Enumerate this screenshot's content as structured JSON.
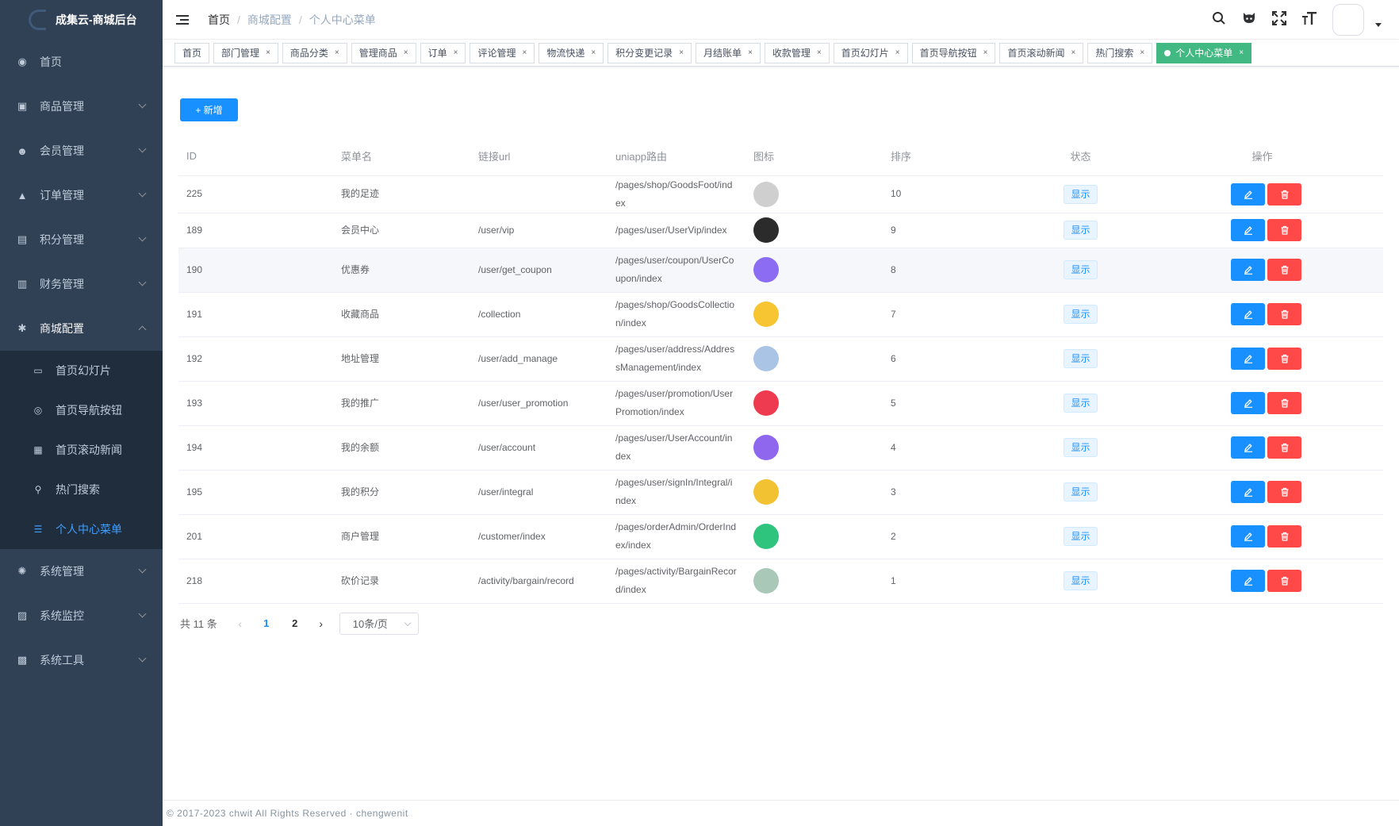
{
  "app": {
    "title": "成集云-商城后台"
  },
  "sidebar": {
    "items": [
      {
        "label": "首页",
        "icon": "dashboard-icon",
        "glyph": "◉",
        "children": false,
        "open": false
      },
      {
        "label": "商品管理",
        "icon": "goods-icon",
        "glyph": "▣",
        "children": true,
        "open": false
      },
      {
        "label": "会员管理",
        "icon": "users-icon",
        "glyph": "☻",
        "children": true,
        "open": false
      },
      {
        "label": "订单管理",
        "icon": "lock-icon",
        "glyph": "▲",
        "children": true,
        "open": false
      },
      {
        "label": "积分管理",
        "icon": "points-icon",
        "glyph": "▤",
        "children": true,
        "open": false
      },
      {
        "label": "财务管理",
        "icon": "finance-icon",
        "glyph": "▥",
        "children": true,
        "open": false
      },
      {
        "label": "商城配置",
        "icon": "gear-icon",
        "glyph": "✱",
        "children": true,
        "open": true
      }
    ],
    "submenu": [
      {
        "label": "首页幻灯片",
        "icon": "slideshow-icon",
        "glyph": "▭",
        "active": false
      },
      {
        "label": "首页导航按钮",
        "icon": "nav-button-icon",
        "glyph": "◎",
        "active": false
      },
      {
        "label": "首页滚动新闻",
        "icon": "news-icon",
        "glyph": "▦",
        "active": false
      },
      {
        "label": "热门搜索",
        "icon": "search-icon",
        "glyph": "⚲",
        "active": false
      },
      {
        "label": "个人中心菜单",
        "icon": "list-icon",
        "glyph": "☰",
        "active": true
      }
    ],
    "items_after": [
      {
        "label": "系统管理",
        "icon": "settings-icon",
        "glyph": "✺",
        "children": true
      },
      {
        "label": "系统监控",
        "icon": "monitor-icon",
        "glyph": "▨",
        "children": true
      },
      {
        "label": "系统工具",
        "icon": "toolbox-icon",
        "glyph": "▩",
        "children": true
      }
    ]
  },
  "header": {
    "breadcrumb": [
      "首页",
      "商城配置",
      "个人中心菜单"
    ],
    "icons": [
      "search-icon",
      "github-icon",
      "fullscreen-icon",
      "font-size-icon"
    ]
  },
  "tags": [
    {
      "label": "首页",
      "closable": false,
      "active": false
    },
    {
      "label": "部门管理",
      "closable": true,
      "active": false
    },
    {
      "label": "商品分类",
      "closable": true,
      "active": false
    },
    {
      "label": "管理商品",
      "closable": true,
      "active": false
    },
    {
      "label": "订单",
      "closable": true,
      "active": false
    },
    {
      "label": "评论管理",
      "closable": true,
      "active": false
    },
    {
      "label": "物流快递",
      "closable": true,
      "active": false
    },
    {
      "label": "积分变更记录",
      "closable": true,
      "active": false
    },
    {
      "label": "月结账单",
      "closable": true,
      "active": false
    },
    {
      "label": "收款管理",
      "closable": true,
      "active": false
    },
    {
      "label": "首页幻灯片",
      "closable": true,
      "active": false
    },
    {
      "label": "首页导航按钮",
      "closable": true,
      "active": false
    },
    {
      "label": "首页滚动新闻",
      "closable": true,
      "active": false
    },
    {
      "label": "热门搜索",
      "closable": true,
      "active": false
    },
    {
      "label": "个人中心菜单",
      "closable": true,
      "active": true
    }
  ],
  "toolbar": {
    "add_label": "+ 新增"
  },
  "table": {
    "columns": [
      "ID",
      "菜单名",
      "链接url",
      "uniapp路由",
      "图标",
      "排序",
      "状态",
      "操作"
    ],
    "rows": [
      {
        "id": "225",
        "name": "我的足迹",
        "url": "",
        "route": "/pages/shop/GoodsFoot/index",
        "icon": "footprint-icon",
        "icon_color": "#cfcfcf",
        "sort": "10",
        "status": "显示",
        "highlight": false
      },
      {
        "id": "189",
        "name": "会员中心",
        "url": "/user/vip",
        "route": "/pages/user/UserVip/index",
        "icon": "vip-icon",
        "icon_color": "#2b2b2b",
        "sort": "9",
        "status": "显示",
        "highlight": false
      },
      {
        "id": "190",
        "name": "优惠券",
        "url": "/user/get_coupon",
        "route": "/pages/user/coupon/UserCoupon/index",
        "icon": "coupon-icon",
        "icon_color": "#8b6cf2",
        "sort": "8",
        "status": "显示",
        "highlight": true
      },
      {
        "id": "191",
        "name": "收藏商品",
        "url": "/collection",
        "route": "/pages/shop/GoodsCollection/index",
        "icon": "star-icon",
        "icon_color": "#f7c531",
        "sort": "7",
        "status": "显示",
        "highlight": false
      },
      {
        "id": "192",
        "name": "地址管理",
        "url": "/user/add_manage",
        "route": "/pages/user/address/AddressManagement/index",
        "icon": "address-icon",
        "icon_color": "#aac4e6",
        "sort": "6",
        "status": "显示",
        "highlight": false
      },
      {
        "id": "193",
        "name": "我的推广",
        "url": "/user/user_promotion",
        "route": "/pages/user/promotion/UserPromotion/index",
        "icon": "promotion-icon",
        "icon_color": "#ef3b4f",
        "sort": "5",
        "status": "显示",
        "highlight": false
      },
      {
        "id": "194",
        "name": "我的余额",
        "url": "/user/account",
        "route": "/pages/user/UserAccount/index",
        "icon": "yuan-icon",
        "icon_color": "#8f66ee",
        "sort": "4",
        "status": "显示",
        "highlight": false
      },
      {
        "id": "195",
        "name": "我的积分",
        "url": "/user/integral",
        "route": "/pages/user/signIn/Integral/index",
        "icon": "integral-icon",
        "icon_color": "#f2c232",
        "sort": "3",
        "status": "显示",
        "highlight": false
      },
      {
        "id": "201",
        "name": "商户管理",
        "url": "/customer/index",
        "route": "/pages/orderAdmin/OrderIndex/index",
        "icon": "merchant-icon",
        "icon_color": "#2fc47e",
        "sort": "2",
        "status": "显示",
        "highlight": false
      },
      {
        "id": "218",
        "name": "砍价记录",
        "url": "/activity/bargain/record",
        "route": "/pages/activity/BargainRecord/index",
        "icon": "bargain-icon",
        "icon_color": "#a9c8b8",
        "sort": "1",
        "status": "显示",
        "highlight": false
      }
    ]
  },
  "pagination": {
    "total_label": "共 11 条",
    "pages": [
      "1",
      "2"
    ],
    "current": "1",
    "size_label": "10条/页"
  },
  "footer": {
    "text": "© 2017-2023 chwit All Rights Reserved · chengwenit"
  }
}
